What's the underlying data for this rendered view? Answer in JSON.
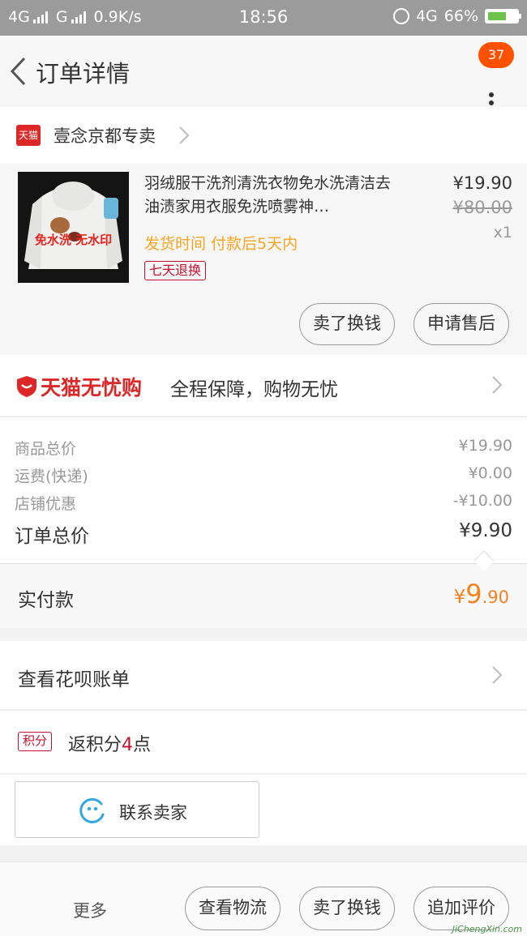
{
  "status_bar": {
    "network1": "4G",
    "network2": "G",
    "speed": "0.9K/s",
    "time": "18:56",
    "network3": "4G",
    "battery_pct": "66%"
  },
  "nav": {
    "title": "订单详情",
    "badge_count": "37"
  },
  "shop": {
    "tag": "天猫",
    "name": "壹念京都专卖"
  },
  "item": {
    "image_caption": "免水洗 无水印",
    "title": "羽绒服干洗剂清洗衣物免水洗清洁去油渍家用衣服免洗喷雾神…",
    "ship_time": "发货时间  付款后5天内",
    "return_tag": "七天退换",
    "price": "¥19.90",
    "orig_price": "¥80.00",
    "qty": "x1",
    "btn_sell": "卖了换钱",
    "btn_aftersale": "申请售后"
  },
  "worry_free": {
    "brand": "天猫无忧购",
    "desc": "全程保障，购物无忧"
  },
  "totals": {
    "rows": [
      {
        "label": "商品总价",
        "value": "¥19.90"
      },
      {
        "label": "运费(快递)",
        "value": "¥0.00"
      },
      {
        "label": "店铺优惠",
        "value": "-¥10.00"
      },
      {
        "label": "订单总价",
        "value": "¥9.90"
      }
    ],
    "paid_label": "实付款",
    "paid_symbol": "¥",
    "paid_int": "9",
    "paid_dec": ".90"
  },
  "huabei": {
    "label": "查看花呗账单"
  },
  "points": {
    "tag": "积分",
    "prefix": "返积分",
    "count": "4",
    "suffix": "点"
  },
  "contact": {
    "label": "联系卖家"
  },
  "bottom": {
    "more": "更多",
    "btn_logistics": "查看物流",
    "btn_sell": "卖了换钱",
    "btn_review": "追加评价",
    "watermark": "JiChengXin.com"
  },
  "colors": {
    "accent_orange": "#ff5000",
    "tmall_red": "#dd2727",
    "price_orange": "#f5821f",
    "ship_yellow": "#f5a623"
  }
}
